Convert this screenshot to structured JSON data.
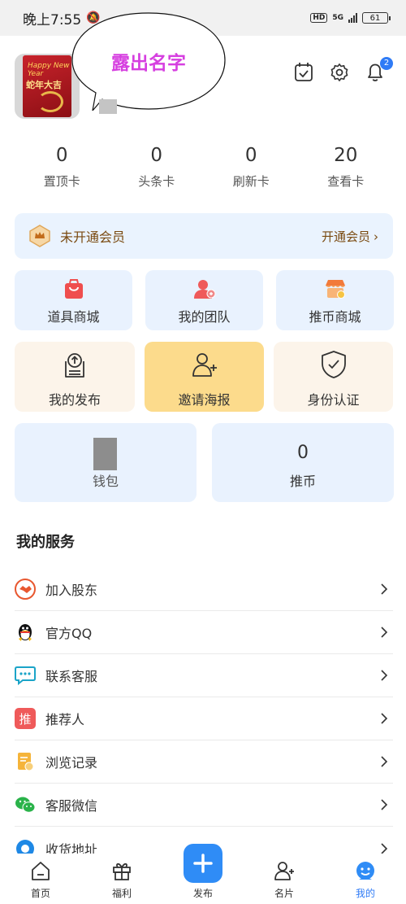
{
  "status": {
    "time": "晚上7:55",
    "hd": "HD",
    "network": "5G",
    "battery": "61"
  },
  "header": {
    "bubble_text": "露出名字",
    "avatar_text_en": "Happy New Year",
    "avatar_text_cn": "蛇年大吉",
    "notification_count": "2"
  },
  "stats": [
    {
      "value": "0",
      "label": "置顶卡"
    },
    {
      "value": "0",
      "label": "头条卡"
    },
    {
      "value": "0",
      "label": "刷新卡"
    },
    {
      "value": "20",
      "label": "查看卡"
    }
  ],
  "vip": {
    "status": "未开通会员",
    "action": "开通会员"
  },
  "tiles": {
    "props_mall": "道具商城",
    "my_team": "我的团队",
    "coin_mall": "推币商城",
    "my_posts": "我的发布",
    "invite_poster": "邀请海报",
    "identity": "身份认证"
  },
  "wallet": {
    "label": "钱包"
  },
  "coins": {
    "value": "0",
    "label": "推币"
  },
  "services": {
    "title": "我的服务",
    "items": [
      {
        "label": "加入股东",
        "icon": "handshake-icon"
      },
      {
        "label": "官方QQ",
        "icon": "qq-penguin-icon"
      },
      {
        "label": "联系客服",
        "icon": "chat-bubble-icon"
      },
      {
        "label": "推荐人",
        "icon": "recommend-icon",
        "glyph": "推"
      },
      {
        "label": "浏览记录",
        "icon": "history-note-icon"
      },
      {
        "label": "客服微信",
        "icon": "wechat-icon"
      },
      {
        "label": "收货地址",
        "icon": "location-icon"
      }
    ]
  },
  "nav": [
    {
      "label": "首页",
      "icon": "home-icon"
    },
    {
      "label": "福利",
      "icon": "gift-icon"
    },
    {
      "label": "发布",
      "icon": "plus-icon"
    },
    {
      "label": "名片",
      "icon": "card-person-icon"
    },
    {
      "label": "我的",
      "icon": "profile-icon"
    }
  ],
  "colors": {
    "accent": "#2f8cf6",
    "vip_text": "#7a4a10",
    "bubble_text": "#d63fe0",
    "gold_tile": "#fcdb8c"
  }
}
